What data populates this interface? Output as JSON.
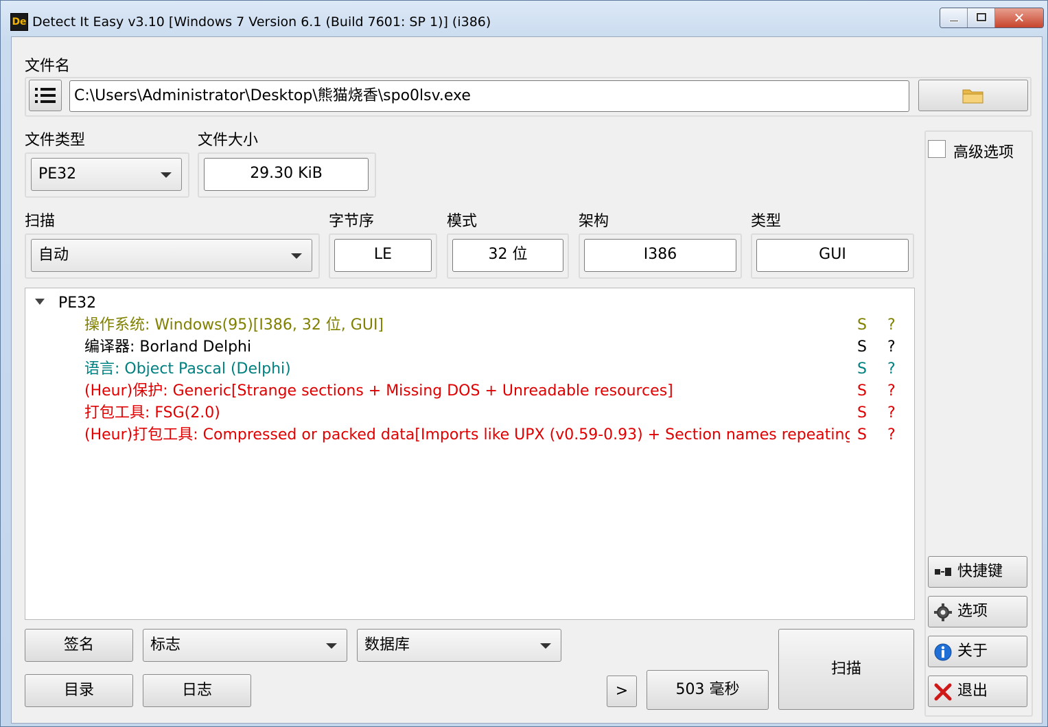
{
  "window": {
    "title": "Detect It Easy v3.10 [Windows 7 Version 6.1 (Build 7601: SP 1)] (i386)",
    "icon_text": "De",
    "close_glyph": "✕"
  },
  "file": {
    "label": "文件名",
    "path": "C:\\Users\\Administrator\\Desktop\\熊猫烧香\\spo0lsv.exe"
  },
  "file_type": {
    "label": "文件类型",
    "value": "PE32"
  },
  "file_size": {
    "label": "文件大小",
    "value": "29.30 KiB"
  },
  "scan": {
    "label": "扫描",
    "value": "自动"
  },
  "endianness": {
    "label": "字节序",
    "value": "LE"
  },
  "mode": {
    "label": "模式",
    "value": "32 位"
  },
  "arch": {
    "label": "架构",
    "value": "I386"
  },
  "type": {
    "label": "类型",
    "value": "GUI"
  },
  "advanced": {
    "label": "高级选项",
    "checked": false
  },
  "results": {
    "root": "PE32",
    "rows": [
      {
        "text": "操作系统: Windows(95)[I386, 32 位, GUI]",
        "s": "S",
        "q": "?",
        "color": "#808000"
      },
      {
        "text": "编译器: Borland Delphi",
        "s": "S",
        "q": "?",
        "color": "#000000"
      },
      {
        "text": "语言: Object Pascal (Delphi)",
        "s": "S",
        "q": "?",
        "color": "#008080"
      },
      {
        "text": "(Heur)保护: Generic[Strange sections + Missing DOS + Unreadable resources]",
        "s": "S",
        "q": "?",
        "color": "#e00000"
      },
      {
        "text": "打包工具: FSG(2.0)",
        "s": "S",
        "q": "?",
        "color": "#e00000"
      },
      {
        "text": "(Heur)打包工具: Compressed or packed data[Imports like UPX (v0.59-0.93) + Section names repeating +...",
        "s": "S",
        "q": "?",
        "color": "#e00000"
      }
    ]
  },
  "bottom": {
    "signature": "签名",
    "flags": "标志",
    "database": "数据库",
    "directory": "目录",
    "log": "日志",
    "more": ">",
    "elapsed": "503 毫秒",
    "scan_button": "扫描"
  },
  "side": {
    "shortcuts": "快捷键",
    "options": "选项",
    "about": "关于",
    "exit": "退出"
  }
}
